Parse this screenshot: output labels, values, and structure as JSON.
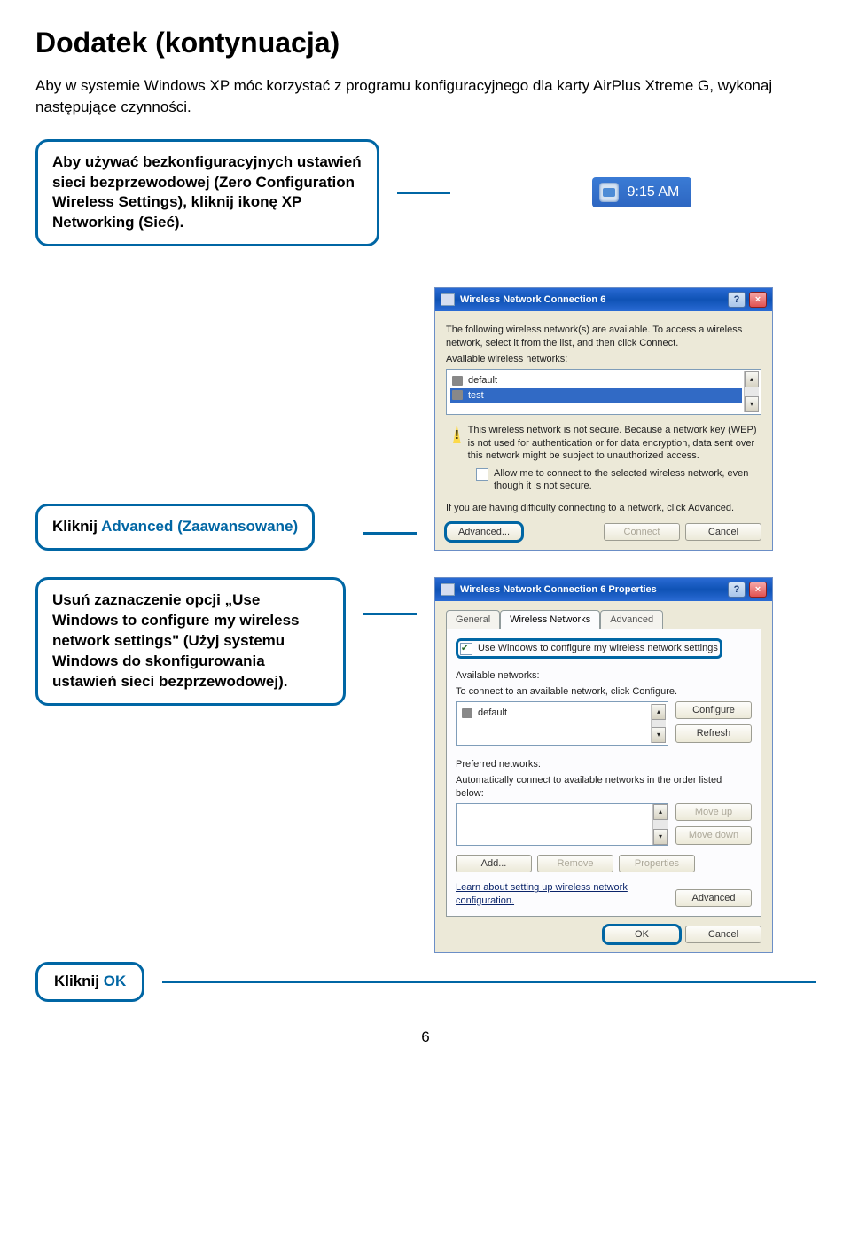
{
  "title": "Dodatek (kontynuacja)",
  "intro": "Aby w systemie Windows XP móc korzystać z programu konfiguracyjnego dla karty AirPlus Xtreme G, wykonaj następujące czynności.",
  "callout1": {
    "text": "Aby używać bezkonfiguracyjnych ustawień sieci bezprzewodowej (Zero Configuration Wireless Settings), kliknij ikonę XP Networking (Sieć)."
  },
  "systray_time": "9:15 AM",
  "dlg1": {
    "title": "Wireless Network Connection 6",
    "desc": "The following wireless network(s) are available. To access a wireless network, select it from the list, and then click Connect.",
    "list_label": "Available wireless networks:",
    "items": [
      "default",
      "test"
    ],
    "warn": "This wireless network is not secure. Because a network key (WEP) is not used for authentication or for data encryption, data sent over this network might be subject to unauthorized access.",
    "allow": "Allow me to connect to the selected wireless network, even though it is not secure.",
    "having": "If you are having difficulty connecting to a network, click Advanced.",
    "advanced": "Advanced...",
    "connect": "Connect",
    "cancel": "Cancel"
  },
  "callout2_a": "Kliknij ",
  "callout2_b": "Advanced (Zaawansowane)",
  "callout3": "Usuń zaznaczenie opcji „Use Windows to configure my wireless network settings\" (Użyj systemu Windows do skonfigurowania ustawień sieci bezprzewodowej).",
  "dlg2": {
    "title": "Wireless Network Connection 6 Properties",
    "tabs": [
      "General",
      "Wireless Networks",
      "Advanced"
    ],
    "use_windows": "Use Windows to configure my wireless network settings",
    "avail_label": "Available networks:",
    "avail_help": "To connect to an available network, click Configure.",
    "avail_item": "default",
    "configure": "Configure",
    "refresh": "Refresh",
    "pref_label": "Preferred networks:",
    "pref_help": "Automatically connect to available networks in the order listed below:",
    "moveup": "Move up",
    "movedown": "Move down",
    "add": "Add...",
    "remove": "Remove",
    "properties": "Properties",
    "learn": "Learn about setting up wireless network configuration.",
    "advanced": "Advanced",
    "ok": "OK",
    "cancel": "Cancel"
  },
  "callout4_a": "Kliknij ",
  "callout4_b": "OK",
  "page_number": "6"
}
